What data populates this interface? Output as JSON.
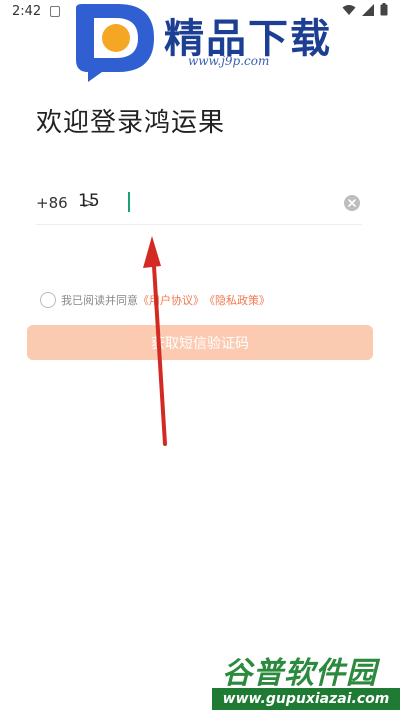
{
  "status_bar": {
    "time": "2:42"
  },
  "watermark_top": {
    "title": "精品下载",
    "url": "www.j9p.com"
  },
  "page": {
    "title": "欢迎登录鸿运果"
  },
  "phone": {
    "country_code": "+86",
    "chevron": ">",
    "value": "15"
  },
  "agreement": {
    "prefix": "我已阅读并同意",
    "user_agreement": "《用户协议》",
    "privacy_policy": "《隐私政策》"
  },
  "button": {
    "label": "获取短信验证码"
  },
  "watermark_bottom": {
    "title": "谷普软件园",
    "url": "www.gupuxiazai.com"
  },
  "colors": {
    "accent_orange": "#f07a50",
    "button_disabled": "#fbc8ad",
    "annotation_arrow": "#d42a24",
    "caret": "#19a27a"
  }
}
